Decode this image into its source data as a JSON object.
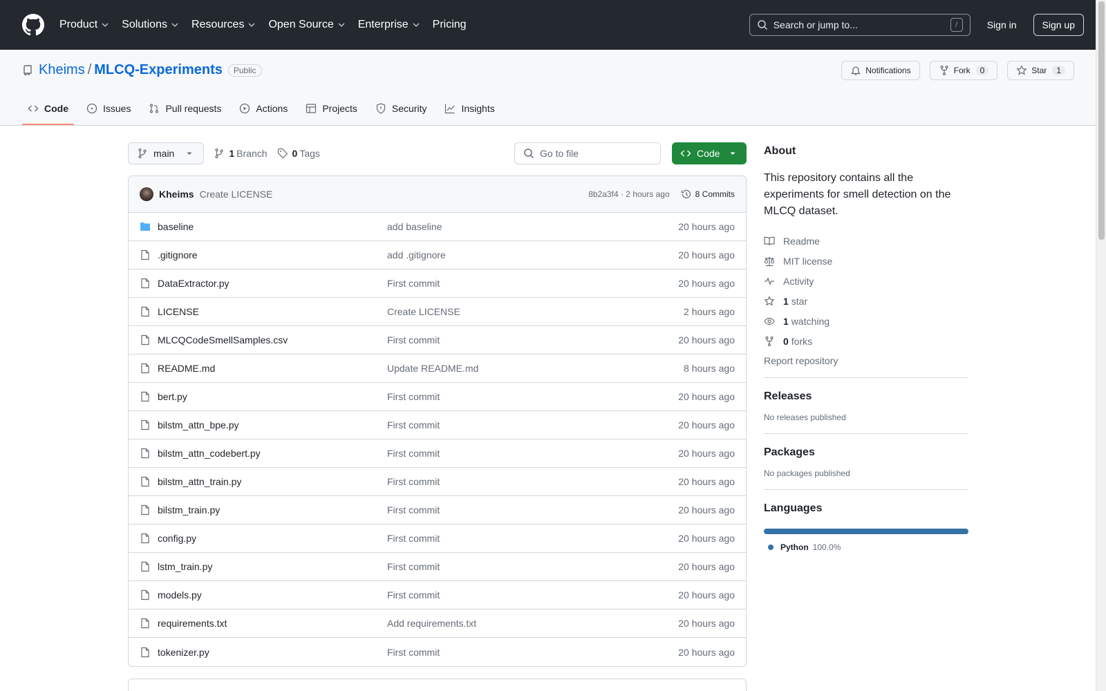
{
  "header": {
    "nav": [
      "Product",
      "Solutions",
      "Resources",
      "Open Source",
      "Enterprise",
      "Pricing"
    ],
    "search_placeholder": "Search or jump to...",
    "search_shortcut": "/",
    "sign_in": "Sign in",
    "sign_up": "Sign up"
  },
  "repo": {
    "owner": "Kheims",
    "separator": "/",
    "name": "MLCQ-Experiments",
    "visibility": "Public",
    "notifications": "Notifications",
    "fork_label": "Fork",
    "fork_count": "0",
    "star_label": "Star",
    "star_count": "1"
  },
  "tabs": [
    "Code",
    "Issues",
    "Pull requests",
    "Actions",
    "Projects",
    "Security",
    "Insights"
  ],
  "toolbar": {
    "branch": "main",
    "branch_count": "1",
    "branch_label": "Branch",
    "tag_count": "0",
    "tag_label": "Tags",
    "goto_placeholder": "Go to file",
    "code_button": "Code"
  },
  "latest_commit": {
    "author": "Kheims",
    "message": "Create LICENSE",
    "hash_time": "8b2a3f4 · 2 hours ago",
    "commits": "8 Commits"
  },
  "files": [
    {
      "name": "baseline",
      "type": "folder",
      "message": "add baseline",
      "time": "20 hours ago"
    },
    {
      "name": ".gitignore",
      "type": "file",
      "message": "add .gitignore",
      "time": "20 hours ago"
    },
    {
      "name": "DataExtractor.py",
      "type": "file",
      "message": "First commit",
      "time": "20 hours ago"
    },
    {
      "name": "LICENSE",
      "type": "file",
      "message": "Create LICENSE",
      "time": "2 hours ago"
    },
    {
      "name": "MLCQCodeSmellSamples.csv",
      "type": "file",
      "message": "First commit",
      "time": "20 hours ago"
    },
    {
      "name": "README.md",
      "type": "file",
      "message": "Update README.md",
      "time": "8 hours ago"
    },
    {
      "name": "bert.py",
      "type": "file",
      "message": "First commit",
      "time": "20 hours ago"
    },
    {
      "name": "bilstm_attn_bpe.py",
      "type": "file",
      "message": "First commit",
      "time": "20 hours ago"
    },
    {
      "name": "bilstm_attn_codebert.py",
      "type": "file",
      "message": "First commit",
      "time": "20 hours ago"
    },
    {
      "name": "bilstm_attn_train.py",
      "type": "file",
      "message": "First commit",
      "time": "20 hours ago"
    },
    {
      "name": "bilstm_train.py",
      "type": "file",
      "message": "First commit",
      "time": "20 hours ago"
    },
    {
      "name": "config.py",
      "type": "file",
      "message": "First commit",
      "time": "20 hours ago"
    },
    {
      "name": "lstm_train.py",
      "type": "file",
      "message": "First commit",
      "time": "20 hours ago"
    },
    {
      "name": "models.py",
      "type": "file",
      "message": "First commit",
      "time": "20 hours ago"
    },
    {
      "name": "requirements.txt",
      "type": "file",
      "message": "Add requirements.txt",
      "time": "20 hours ago"
    },
    {
      "name": "tokenizer.py",
      "type": "file",
      "message": "First commit",
      "time": "20 hours ago"
    }
  ],
  "sidebar": {
    "about_title": "About",
    "description": "This repository contains all the experiments for smell detection on the MLCQ dataset.",
    "readme": "Readme",
    "license": "MIT license",
    "activity": "Activity",
    "stars_count": "1",
    "stars_label": "star",
    "watching_count": "1",
    "watching_label": "watching",
    "forks_count": "0",
    "forks_label": "forks",
    "report": "Report repository",
    "releases_title": "Releases",
    "releases_text": "No releases published",
    "packages_title": "Packages",
    "packages_text": "No packages published",
    "languages_title": "Languages",
    "language_name": "Python",
    "language_percent": "100.0%",
    "language_color": "#3572a5"
  }
}
